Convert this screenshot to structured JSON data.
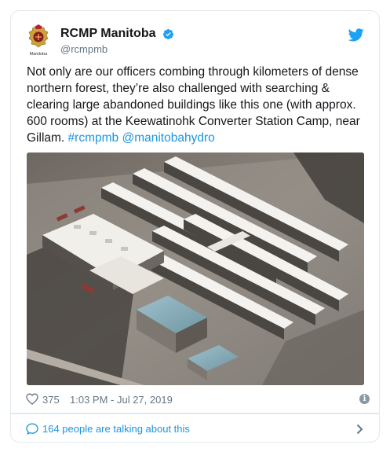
{
  "account": {
    "display_name": "RCMP Manitoba",
    "handle": "@rcmpmb",
    "badge_caption": "Manitoba",
    "avatar_icon": "rcmp-crest-icon",
    "verified_icon": "verified-badge-icon",
    "platform_icon": "twitter-bird-icon"
  },
  "tweet": {
    "text_plain": "Not only are our officers combing through kilometers of dense northern forest, they’re also challenged with searching & clearing large abandoned buildings like this one (with approx. 600 rooms) at the Keewatinohk Converter Station Camp, near Gillam. ",
    "hashtag": "#rcmpmb",
    "mention": "@manitobahydro",
    "media_icon": "aerial-photo-camp-buildings"
  },
  "meta": {
    "like_count": "375",
    "timestamp": "1:03 PM - Jul 27, 2019",
    "info_glyph": "i"
  },
  "footer": {
    "talking_text": "164 people are talking about this"
  },
  "colors": {
    "link": "#1b95e0",
    "secondary_text": "#657786",
    "border": "#e1e8ed",
    "verified": "#1da1f2"
  }
}
